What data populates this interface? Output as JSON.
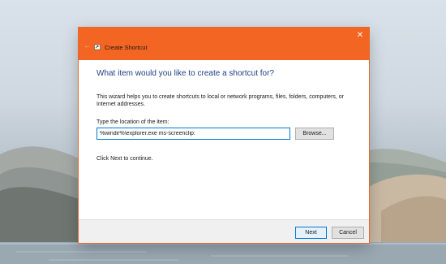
{
  "window": {
    "title": "Create Shortcut",
    "back_icon": "back-arrow-icon",
    "app_icon": "shortcut-wizard-icon",
    "close_icon": "close-icon",
    "close_glyph": "✕",
    "back_glyph": "←"
  },
  "wizard": {
    "heading": "What item would you like to create a shortcut for?",
    "description": "This wizard helps you to create shortcuts to local or network programs, files, folders, computers, or Internet addresses.",
    "location_label": "Type the location of the item:",
    "location_value": "%windir%\\explorer.exe ms-screenclip:",
    "browse_label": "Browse...",
    "hint": "Click Next to continue."
  },
  "footer": {
    "next_label": "Next",
    "cancel_label": "Cancel"
  },
  "colors": {
    "titlebar": "#f26522",
    "heading": "#1f3f86",
    "focus_border": "#0078d7"
  }
}
